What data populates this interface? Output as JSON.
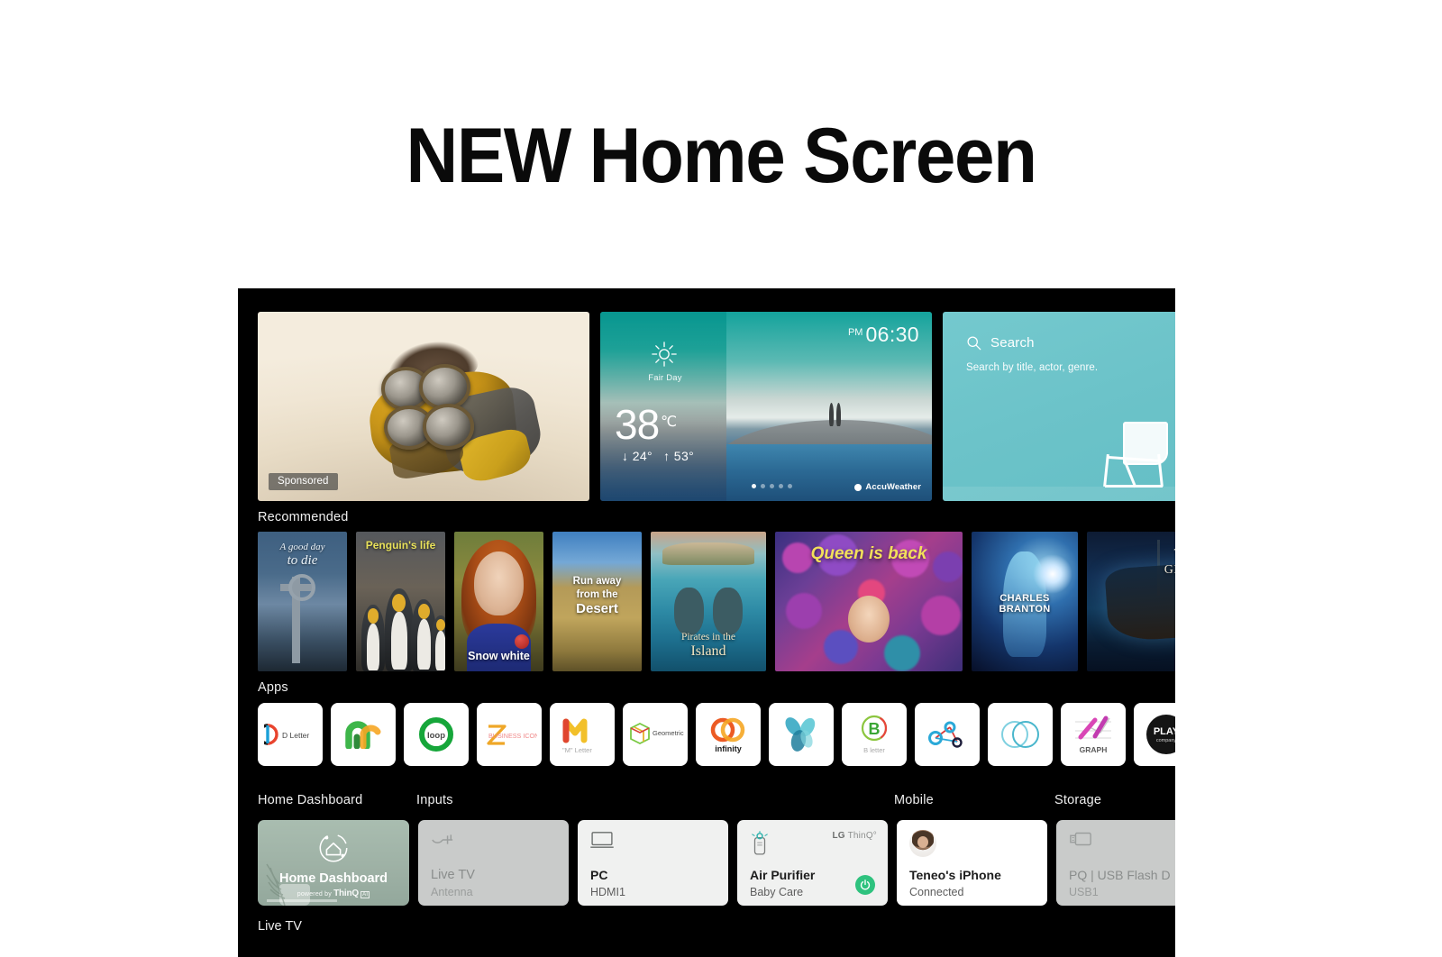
{
  "page": {
    "title": "NEW Home Screen"
  },
  "hero": {
    "ad": {
      "badge": "Sponsored",
      "name": "sponsored-ad-card"
    },
    "weather": {
      "condition": "Fair Day",
      "temperature": "38",
      "unit": "℃",
      "low": "↓ 24°",
      "high": "↑ 53°",
      "time": "06:30",
      "ampm": "PM",
      "provider": "AccuWeather",
      "dots": 5,
      "active_dot": 1
    },
    "search": {
      "label": "Search",
      "hint": "Search by title, actor, genre."
    }
  },
  "sections": {
    "recommended": "Recommended",
    "apps": "Apps",
    "home_dashboard": "Home Dashboard",
    "inputs": "Inputs",
    "mobile": "Mobile",
    "storage": "Storage",
    "live_tv": "Live TV"
  },
  "recommended": [
    {
      "line1": "A good day",
      "line2": "to die"
    },
    {
      "line1": "Penguin's life",
      "line2": ""
    },
    {
      "line1": "",
      "line2": "Snow white"
    },
    {
      "line1": "Run away\nfrom the",
      "line2": "Desert"
    },
    {
      "line1": "Pirates in the",
      "line2": "Island"
    },
    {
      "line1": "Queen is back",
      "line2": ""
    },
    {
      "line1": "CHARLES BRANTON",
      "line2": ""
    },
    {
      "line1": "THE DARK",
      "line2": "GHOST SHIP"
    }
  ],
  "apps": [
    {
      "label": "D Letter",
      "icon": "d-letter-icon"
    },
    {
      "label": "",
      "icon": "m-arch-icon"
    },
    {
      "label": "loop",
      "icon": "loop-ring-icon"
    },
    {
      "label": "BUSINESS ICON",
      "icon": "z-business-icon"
    },
    {
      "label": "\"M\" Letter",
      "icon": "m-letter-icon"
    },
    {
      "label": "Geometric",
      "icon": "geometric-cube-icon"
    },
    {
      "label": "infinity",
      "icon": "infinity-rings-icon"
    },
    {
      "label": "",
      "icon": "leaf-teal-icon"
    },
    {
      "label": "B letter",
      "icon": "b-letter-icon"
    },
    {
      "label": "",
      "icon": "molecule-node-icon"
    },
    {
      "label": "",
      "icon": "double-circle-icon"
    },
    {
      "label": "GRAPH",
      "icon": "graph-chart-icon"
    },
    {
      "label": "PLAY",
      "sub": "company",
      "icon": "play-company-icon"
    }
  ],
  "dashboard": [
    {
      "title": "Home Dashboard",
      "sub": "",
      "powered_prefix": "powered by",
      "powered": "ThinQ",
      "badge": "AI",
      "icon": "home-dashboard-icon",
      "state": "selected"
    },
    {
      "title": "Live TV",
      "sub": "Antenna",
      "icon": "antenna-input-icon",
      "state": "dim"
    },
    {
      "title": "PC",
      "sub": "HDMI1",
      "icon": "monitor-icon",
      "state": "normal"
    },
    {
      "title": "Air Purifier",
      "sub": "Baby Care",
      "brand_lg": "LG",
      "brand_thinq": "ThinQ°",
      "icon": "air-purifier-icon",
      "state": "normal",
      "power": "power-button"
    },
    {
      "title": "Teneo's iPhone",
      "sub": "Connected",
      "icon": "avatar-icon",
      "state": "normal"
    },
    {
      "title": "PQ | USB Flash D",
      "sub": "USB1",
      "icon": "usb-icon",
      "state": "dim"
    }
  ],
  "colors": {
    "tv_background": "#000000",
    "search_card": "#6cc3c9",
    "weather_top": "#0f9e99",
    "dashboard_selected": "#a9bdb0",
    "power_green": "#2ec27e",
    "page_background": "#ffffff",
    "title_text": "#0a0a0a"
  }
}
